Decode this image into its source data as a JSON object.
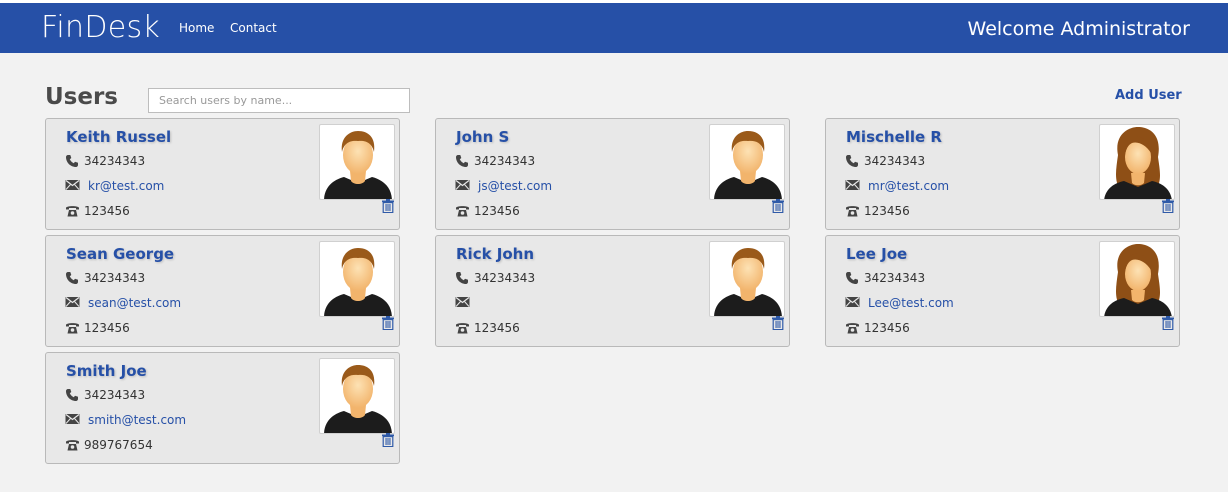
{
  "header": {
    "brand": "FinDesk",
    "nav": [
      {
        "label": "Home"
      },
      {
        "label": "Contact"
      }
    ],
    "welcome": "Welcome Administrator"
  },
  "main": {
    "title": "Users",
    "search": {
      "placeholder": "Search users by name...",
      "value": ""
    },
    "add_user_label": "Add User"
  },
  "users": [
    {
      "name": "Keith Russel",
      "phone": "34234343",
      "email": "kr@test.com",
      "ext": "123456",
      "avatar": "male-avatar-icon"
    },
    {
      "name": "John S",
      "phone": "34234343",
      "email": "js@test.com",
      "ext": "123456",
      "avatar": "male-avatar-icon"
    },
    {
      "name": "Mischelle R",
      "phone": "34234343",
      "email": "mr@test.com",
      "ext": "123456",
      "avatar": "female-avatar-icon"
    },
    {
      "name": "Sean George",
      "phone": "34234343",
      "email": "sean@test.com",
      "ext": "123456",
      "avatar": "male-avatar-icon"
    },
    {
      "name": "Rick John",
      "phone": "34234343",
      "email": "",
      "ext": "123456",
      "avatar": "male-avatar-icon"
    },
    {
      "name": "Lee Joe",
      "phone": "34234343",
      "email": "Lee@test.com",
      "ext": "123456",
      "avatar": "female-avatar-icon"
    },
    {
      "name": "Smith Joe",
      "phone": "34234343",
      "email": "smith@test.com",
      "ext": "989767654",
      "avatar": "male-avatar-icon"
    }
  ],
  "colors": {
    "navbar": "#2650a7",
    "accent": "#2650a7",
    "background": "#f2f2f2",
    "card": "#e8e8e8"
  }
}
